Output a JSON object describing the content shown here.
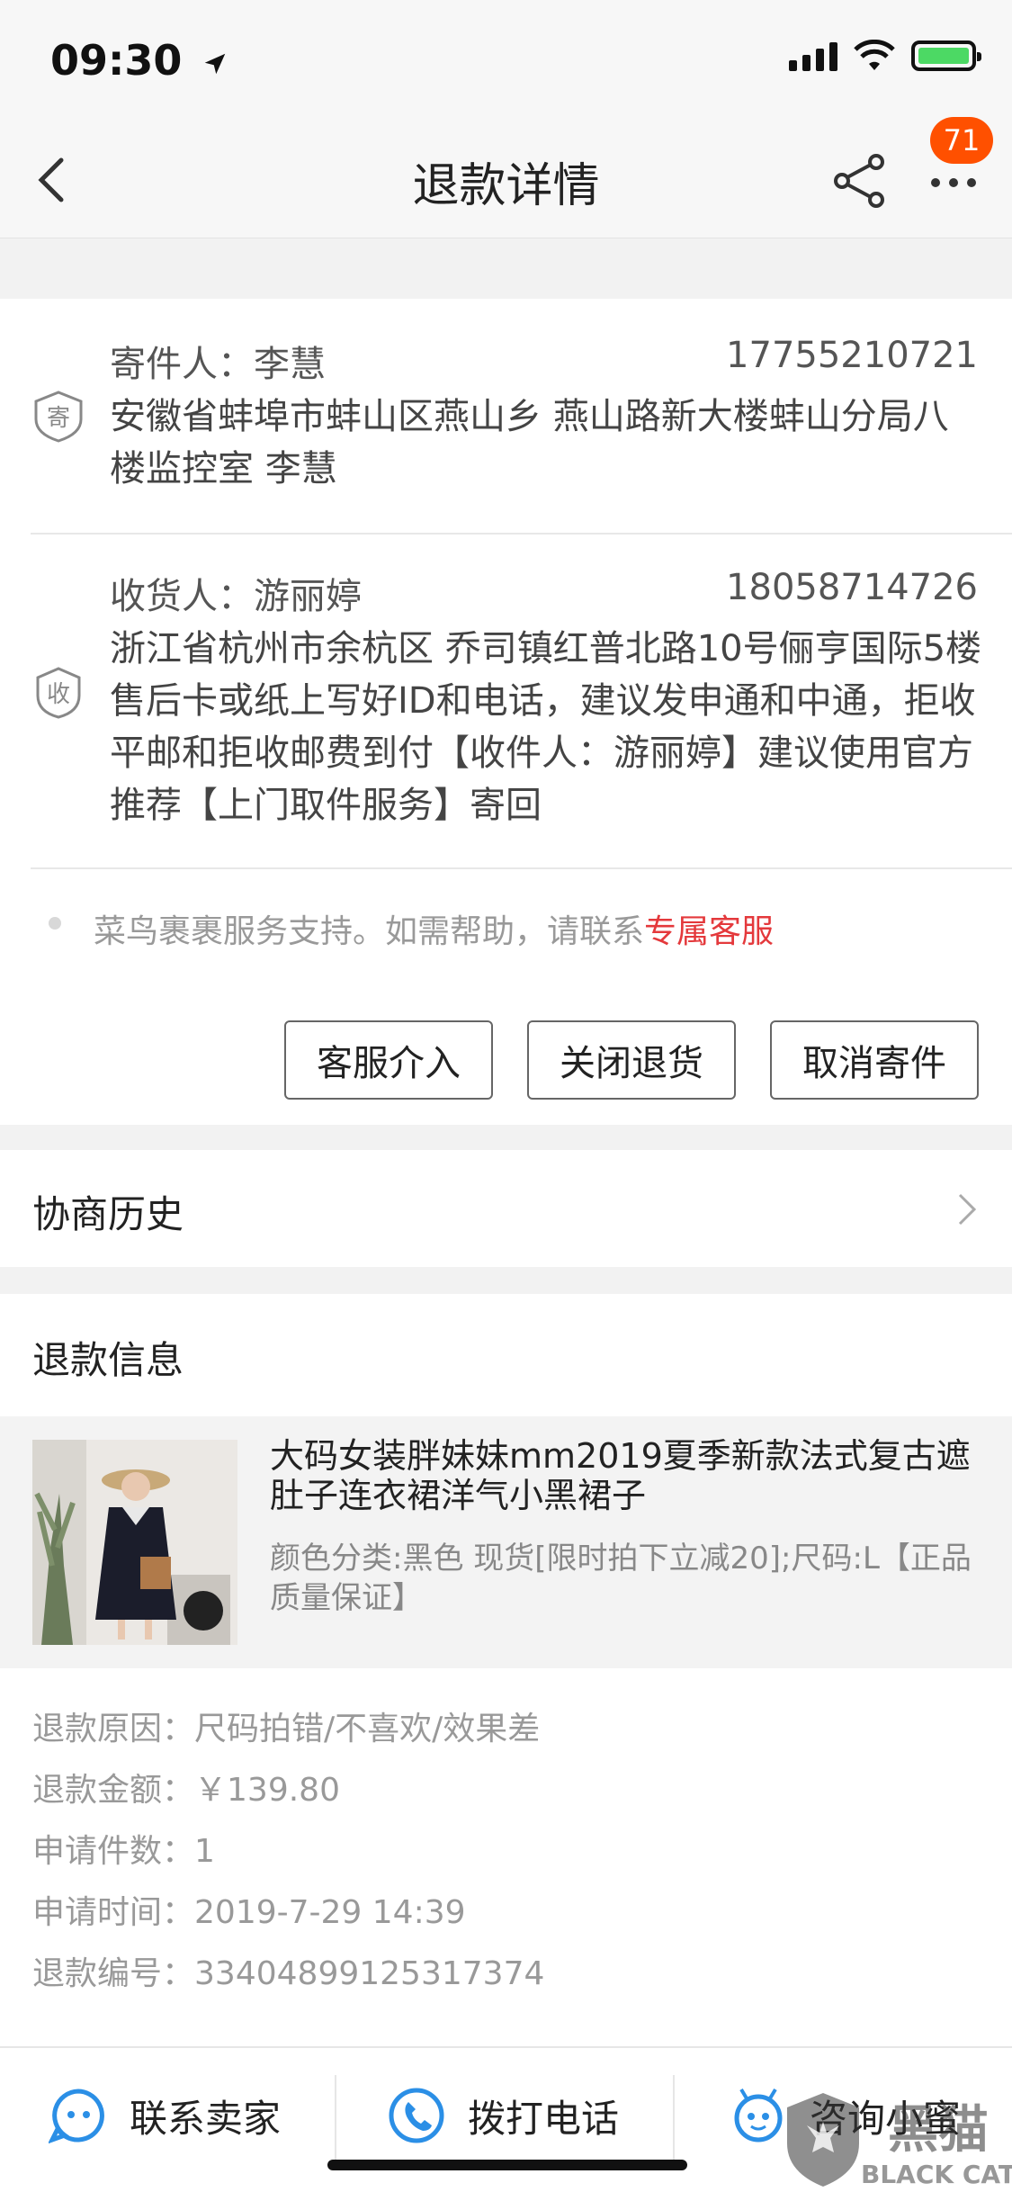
{
  "status_bar": {
    "time": "09:30"
  },
  "nav": {
    "title": "退款详情",
    "badge_count": "71"
  },
  "sender": {
    "label": "寄件人：李慧",
    "phone": "17755210721",
    "address": "安徽省蚌埠市蚌山区燕山乡 燕山路新大楼蚌山分局八楼监控室 李慧",
    "icon_char": "寄"
  },
  "receiver": {
    "label": "收货人：游丽婷",
    "phone": "18058714726",
    "address": "浙江省杭州市余杭区 乔司镇红普北路10号俪亨国际5楼 售后卡或纸上写好ID和电话，建议发申通和中通，拒收平邮和拒收邮费到付【收件人：游丽婷】建议使用官方推荐【上门取件服务】寄回",
    "icon_char": "收"
  },
  "support": {
    "text": "菜鸟裹裹服务支持。如需帮助，请联系",
    "link": "专属客服"
  },
  "actions": {
    "intervene": "客服介入",
    "close_return": "关闭退货",
    "cancel_shipping": "取消寄件"
  },
  "history": {
    "title": "协商历史"
  },
  "refund": {
    "title": "退款信息",
    "product_title": "大码女装胖妹妹mm2019夏季新款法式复古遮肚子连衣裙洋气小黑裙子",
    "product_sku": "颜色分类:黑色 现货[限时拍下立减20];尺码:L【正品质量保证】",
    "reason_label": "退款原因：",
    "reason_value": "尺码拍错/不喜欢/效果差",
    "amount_label": "退款金额：",
    "amount_value": "￥139.80",
    "count_label": "申请件数：",
    "count_value": "1",
    "time_label": "申请时间：",
    "time_value": "2019-7-29 14:39",
    "number_label": "退款编号：",
    "number_value": "33404899125317374"
  },
  "bottom_tabs": {
    "contact_seller": "联系卖家",
    "call_phone": "拨打电话",
    "consult": "咨询小蜜"
  },
  "watermark": {
    "text_cn": "黑猫",
    "text_en": "BLACK CAT"
  },
  "colors": {
    "accent": "#ff5000",
    "link": "#e4393c",
    "icon_blue": "#2b8fe6"
  }
}
